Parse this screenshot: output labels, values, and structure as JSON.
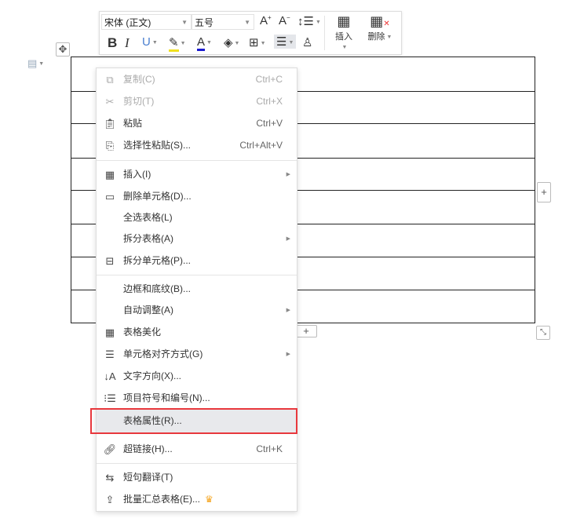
{
  "toolbar": {
    "font_name": "宋体 (正文)",
    "font_size": "五号",
    "insert_label": "插入",
    "delete_label": "删除"
  },
  "context_menu": {
    "items": [
      {
        "label": "复制(C)",
        "shortcut": "Ctrl+C",
        "icon": "copy-icon",
        "disabled": true
      },
      {
        "label": "剪切(T)",
        "shortcut": "Ctrl+X",
        "icon": "cut-icon",
        "disabled": true
      },
      {
        "label": "粘贴",
        "shortcut": "Ctrl+V",
        "icon": "paste-icon"
      },
      {
        "label": "选择性粘贴(S)...",
        "shortcut": "Ctrl+Alt+V",
        "icon": "paste-special-icon"
      },
      {
        "label": "插入(I)",
        "icon": "table-insert-icon",
        "submenu": true
      },
      {
        "label": "删除单元格(D)...",
        "icon": "delete-cell-icon"
      },
      {
        "label": "全选表格(L)"
      },
      {
        "label": "拆分表格(A)",
        "submenu": true
      },
      {
        "label": "拆分单元格(P)...",
        "icon": "split-cell-icon"
      },
      {
        "label": "边框和底纹(B)..."
      },
      {
        "label": "自动调整(A)",
        "submenu": true
      },
      {
        "label": "表格美化",
        "icon": "table-style-icon"
      },
      {
        "label": "单元格对齐方式(G)",
        "icon": "align-icon",
        "submenu": true
      },
      {
        "label": "文字方向(X)...",
        "icon": "text-direction-icon"
      },
      {
        "label": "项目符号和编号(N)...",
        "icon": "list-icon"
      },
      {
        "label": "表格属性(R)...",
        "highlighted": true
      },
      {
        "label": "超链接(H)...",
        "shortcut": "Ctrl+K",
        "icon": "link-icon"
      },
      {
        "label": "短句翻译(T)",
        "icon": "translate-icon"
      },
      {
        "label": "批量汇总表格(E)...",
        "icon": "summary-icon",
        "premium": true
      }
    ]
  },
  "colors": {
    "highlight_box": "#e8383d",
    "crown": "#f5a623"
  }
}
